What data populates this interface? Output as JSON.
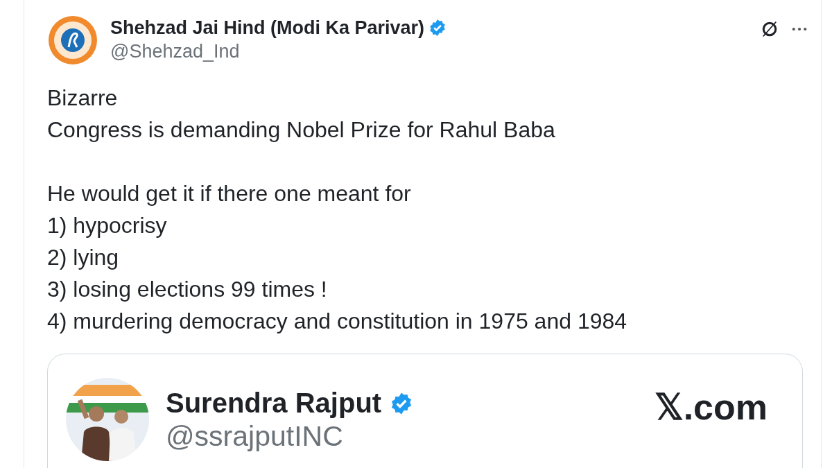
{
  "post": {
    "author": {
      "name": "Shehzad Jai Hind (Modi Ka Parivar)",
      "handle": "@Shehzad_Ind",
      "verified": true
    },
    "paragraphs": [
      [
        "Bizarre",
        "Congress is demanding Nobel Prize for Rahul Baba"
      ],
      [
        "He would get it if there one meant for",
        "1) hypocrisy",
        "2) lying",
        "3) losing elections 99 times !",
        "4) murdering democracy and constitution in 1975 and 1984"
      ]
    ],
    "quoted": {
      "name": "Surendra Rajput",
      "handle": "@ssrajputINC",
      "verified": true,
      "source": "𝕏.com"
    }
  }
}
